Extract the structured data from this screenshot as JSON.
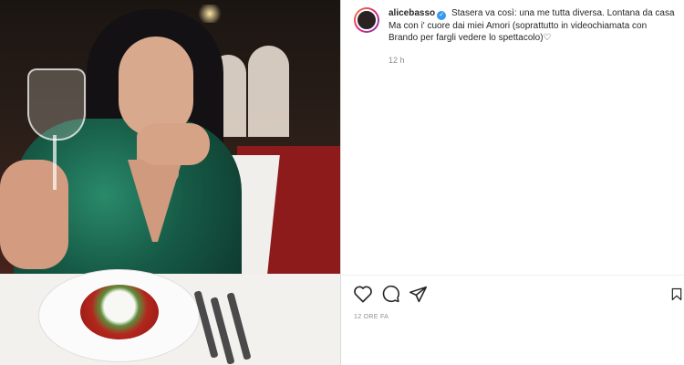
{
  "post": {
    "username": "alicebasso",
    "verified_badge": "✓",
    "caption": "Stasera va così: una me tutta diversa. Lontana da casa\nMa con i' cuore dai miei Amori (soprattutto in videochiamata con\nBrando per fargli vedere lo spettacolo)♡",
    "comment_time": "12 h",
    "post_time": "12 ORE FA"
  },
  "actions": {
    "icons": [
      "heart-icon",
      "comment-icon",
      "share-icon",
      "bookmark-icon"
    ]
  },
  "colors": {
    "accent": "#3897f0",
    "text": "#262626",
    "muted": "#8e8e8e",
    "divider": "#dbdbdb"
  }
}
